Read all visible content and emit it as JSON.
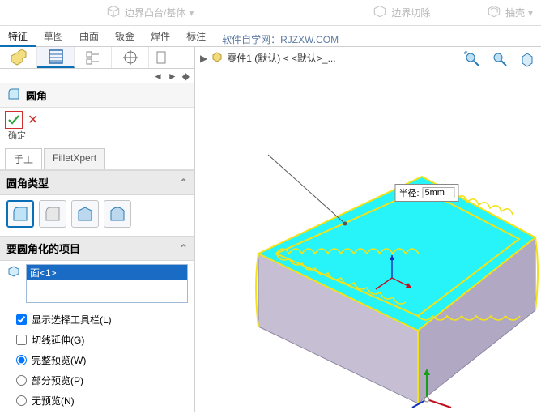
{
  "ribbon": {
    "items": [
      {
        "label": "边界凸台/基体"
      },
      {
        "label": "边界切除"
      },
      {
        "label": "抽壳"
      }
    ]
  },
  "tabs": {
    "items": [
      "特征",
      "草图",
      "曲面",
      "钣金",
      "焊件",
      "标注"
    ],
    "active": 0,
    "link": "软件自学网：RJZXW.COM"
  },
  "feature": {
    "title": "圆角",
    "ok_label": "确定",
    "subtabs": {
      "manual": "手工",
      "xpert": "FilletXpert"
    }
  },
  "fillet_type": {
    "heading": "圆角类型"
  },
  "items_section": {
    "heading": "要圆角化的项目",
    "items": [
      "面<1>"
    ]
  },
  "options": {
    "show_toolbar": "显示选择工具栏(L)",
    "tangent": "切线延伸(G)",
    "full_preview": "完整预览(W)",
    "partial_preview": "部分预览(P)",
    "no_preview": "无预览(N)"
  },
  "viewport": {
    "tree": "零件1 (默认) < <默认>_...",
    "radius_label": "半径:",
    "radius_value": "5mm"
  }
}
